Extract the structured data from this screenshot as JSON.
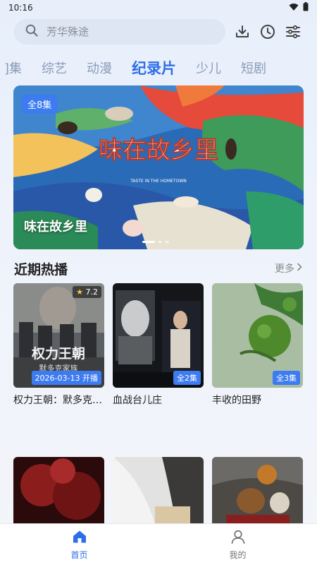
{
  "status": {
    "time": "10:16"
  },
  "search": {
    "placeholder": "芳华殊途"
  },
  "toolbar": {
    "download_icon": "download-icon",
    "history_icon": "history-icon",
    "filter_icon": "filter-icon"
  },
  "tabs": [
    {
      "label": "]集"
    },
    {
      "label": "综艺"
    },
    {
      "label": "动漫"
    },
    {
      "label": "纪录片",
      "active": true
    },
    {
      "label": "少儿"
    },
    {
      "label": "短剧"
    }
  ],
  "banner": {
    "badge": "全8集",
    "title": "味在故乡里",
    "art_text": "味在故乡里",
    "art_subtext": "TASTE IN THE HOMETOWN"
  },
  "section": {
    "title": "近期热播",
    "more": "更多"
  },
  "cards": [
    {
      "title": "权力王朝：默多克家族",
      "rating": "7.2",
      "tag": "2026-03-13 开播",
      "poster_text": "权力王朝",
      "poster_sub": "默多克家族"
    },
    {
      "title": "血战台儿庄",
      "tag": "全2集"
    },
    {
      "title": "丰收的田野",
      "tag": "全3集"
    }
  ],
  "nav": [
    {
      "label": "首页",
      "active": true
    },
    {
      "label": "我的"
    }
  ],
  "colors": {
    "accent": "#2f6ee8",
    "badge": "#3d7bf0"
  }
}
